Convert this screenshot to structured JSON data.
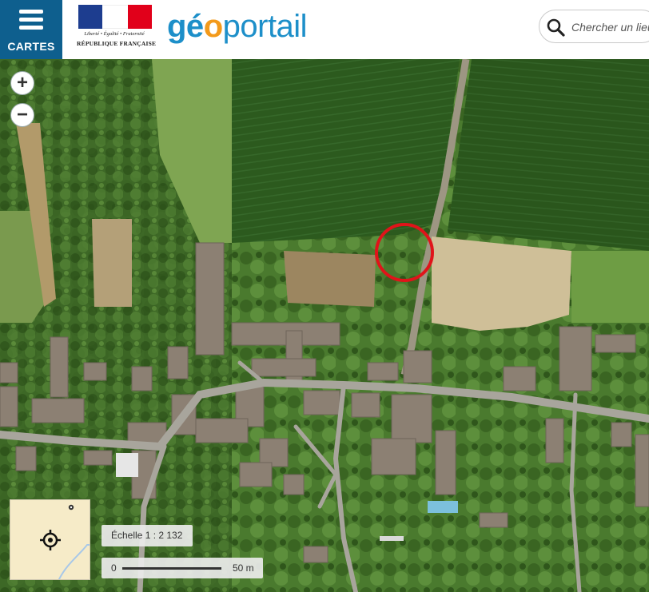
{
  "header": {
    "menu_label": "CARTES",
    "gov_motto": "Liberté • Égalité • Fraternité",
    "gov_name": "RÉPUBLIQUE FRANÇAISE",
    "brand_geo_1": "gé",
    "brand_geo_2": "o",
    "brand_portail": "portail",
    "search_placeholder": "Chercher un lieu"
  },
  "map": {
    "zoom_in": "+",
    "zoom_out": "−",
    "scale_label": "Échelle 1 : 2 132",
    "scale_bar_start": "0",
    "scale_bar_end": "50 m",
    "marker_color": "#e0141a"
  },
  "colors": {
    "menu_bg": "#0e5f8e",
    "brand_blue": "#1d8fc9",
    "brand_orange": "#f39a1b"
  },
  "icons": [
    "menu-icon",
    "search-icon",
    "zoom-in-icon",
    "zoom-out-icon",
    "locate-icon",
    "map-pin-icon"
  ]
}
